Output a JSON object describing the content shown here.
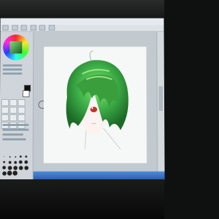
{
  "scene": {
    "subject": "photo-of-monitor",
    "accent": "#3fb24a",
    "screen_bg": "#d9dee2",
    "icons": [
      "color-wheel-icon",
      "brush-icon",
      "eraser-icon",
      "pen-icon"
    ]
  }
}
